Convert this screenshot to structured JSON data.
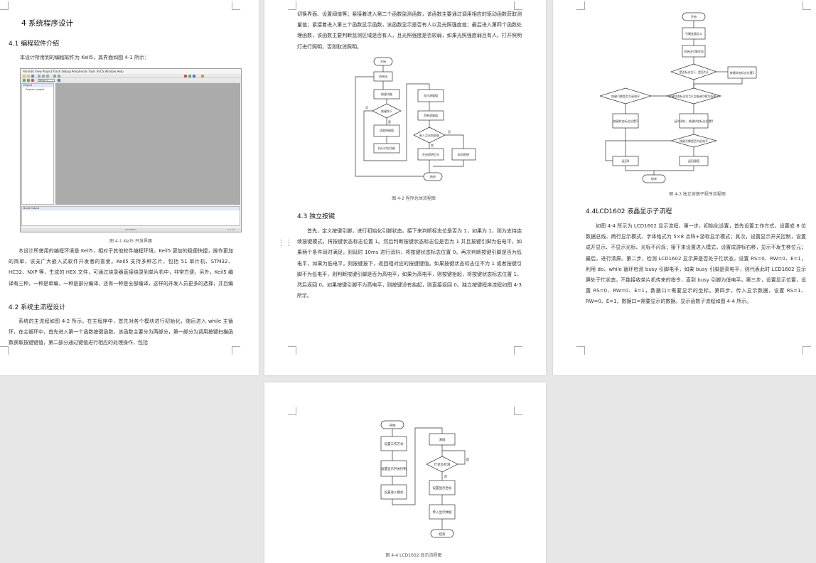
{
  "page1": {
    "chapter_title": "4 系统程序设计",
    "sec41_title": "4.1 编程软件介绍",
    "sec41_intro": "本设计所用到的编程软件为 Keil5，其界面如图 4-1 所示：",
    "ide": {
      "menu": "File  Edit  View  Project  Flash  Debug  Peripherals  Tools  SVCS  Window  Help",
      "target": "Target 1",
      "project_header": "Project",
      "project_item": "Project: project",
      "build_header": "Build Output",
      "status": "Simulation",
      "status_right": "L:1 C:1"
    },
    "fig41_caption": "图 4-1  Keil5 开发界面",
    "sec41_body": "本设计所使用的编程环境是 Keil5，相对于其他软件编程环境，Keil5 更加的稳便快捷，操作更加的简单，该支广大嵌入式软件开发者的喜爱。Keil5 支持多种芯片，包括 51 单片机、STM32、HC32、NXP 等，生成的 HEX 文件，可通过烧录器直接烧录到单片机中，非常方便。另外，Keil5 编译有三种，一种是单编，一种是部分编译，还有一种是全部编译，这样的开发人员更多的选择，并且编译的结果，显示在界面的最下方，供开发者查找错误。",
    "sec42_title": "4.2  系统主流程设计",
    "sec42_body": "系统的主流程如图 4-2 所示。在主程序中，首先对各个模块进行初始化，随后进入 while 主循环，在主循环中，首先进入第一个函数按键函数，该函数主要分为两部分，第一部分为调用按键扫描函数获取按键键值，第二部分通过键值进行相应的处理操作，包括"
  },
  "page2": {
    "top_text": "切换界面、设置阈值等；紧接着进入第二个函数监测函数，该函数主要通过调用相应的驱动函数获取测量值；紧接着进入第三个函数显示函数，该函数显示是否有人以及光照强度值；最后进入第四个函数处理函数，该函数主要判断监测区域是否有人，且光照强度是否较弱，如果光照强度弱且有人，打开照明灯进行照明，否则取消照明。",
    "fig42": {
      "start": "开始",
      "init": "初始化",
      "key_func": "按键功能",
      "key_pressed": "按键按下",
      "read_key": "读取按键值",
      "exec": "执行对应功能",
      "display": "显示测量值",
      "judge": "判断测量值",
      "cond": "有人且光照较弱",
      "light_on": "开启照明灯光",
      "light_off": "取消照明",
      "end": "结束",
      "yes": "是",
      "no": "否"
    },
    "fig42_caption": "图 4-2    程序总体流程图",
    "sec43_title": "4.3  独立按键",
    "sec43_body": "首先，定义按键引脚，进行初始化引脚状态。接下来判断标志位是否为 1，如果为 1，则为支持连续按键模式，将按键状态标志位置 1。然后判断按键状态标志位是否为 1 并且按键引脚为低电平，如果两个条件同时满足，则延时 10ms 进行消抖，将按键状态标志位置 0。再次判断按键引脚是否为低电平，如果为低电平，则按键按下，返回相对应的按键键值。如果按键状态标志位不为 1 或者按键引脚不为低电平，则判断按键引脚是否为高电平，如果为高电平，则按键抬起，将按键状态标志位置 1，然后返回 0。如果按键引脚不为高电平，则按键没有抬起，则直接返回 0。独立按键程序流程如图 4-3 所示。"
  },
  "page3": {
    "fig43": {
      "start": "开始",
      "define": "引脚变量定义",
      "init": "初始化引脚状态",
      "mode": "是否标志位1，是否为1",
      "set_flag": "按键状态标志位置1",
      "cond2": "按键状态标志位为1且按键引脚为低电平",
      "high": "按键引脚是否为高电平",
      "delay": "延时消抖，按键状态标志位置0",
      "low": "按键引脚是否为低电平",
      "set1": "按键状态标志位置1",
      "ret0": "返回0",
      "retkey": "返回键值",
      "end": "结束"
    },
    "fig43_caption": "图 4-3  独立按键子程序流程图",
    "sec44_title": "4.4LCD1602 液晶显示子流程",
    "sec44_body": "如图 4-4 所示为 LCD1602 显示流程，第一步，初始化设置，首先设置工作方式，设置成 8 位数据总线、两行显示模式、字体格式为 5×8 点阵+游标显示模式；其次，设置显示开关控制，设置成开显示、不显示光标、光标不闪烁；接下来设置进入模式，设置成游标右移，显示不发生移位元；最后，进行清屏。第二步，检测 LCD1602 显示屏是否处于忙状态，设置 RS=0、RW=0、E=1，利用 do、while 循环检测 busy 引脚电平，如果 busy 引脚是高电平，则代表此时 LCD1602 显示屏处于忙状态，不能接收单片机传来的指令，直到 busy 引脚为低电平。第三步，设置显示位置，设置 RS=0、RW=0、E=1，数据口=需要显示的坐标。第四步，传入显示数据，设置 RS=1、RW=0、E=1，数据口=需要显示的数据。显示函数子流程如图 4-4 所示。"
  },
  "page4": {
    "fig44": {
      "start": "开始",
      "mode": "设置工作方式",
      "disp": "设置显示开关控制",
      "entry": "设置进入模式",
      "clear": "清屏",
      "busy": "忙状态检测",
      "pos": "设置显示坐标",
      "data": "传入显示数据",
      "end": "结束",
      "yes": "是",
      "no": "否"
    },
    "fig44_caption": "图 4-4 LCD1602 显示流程图"
  }
}
